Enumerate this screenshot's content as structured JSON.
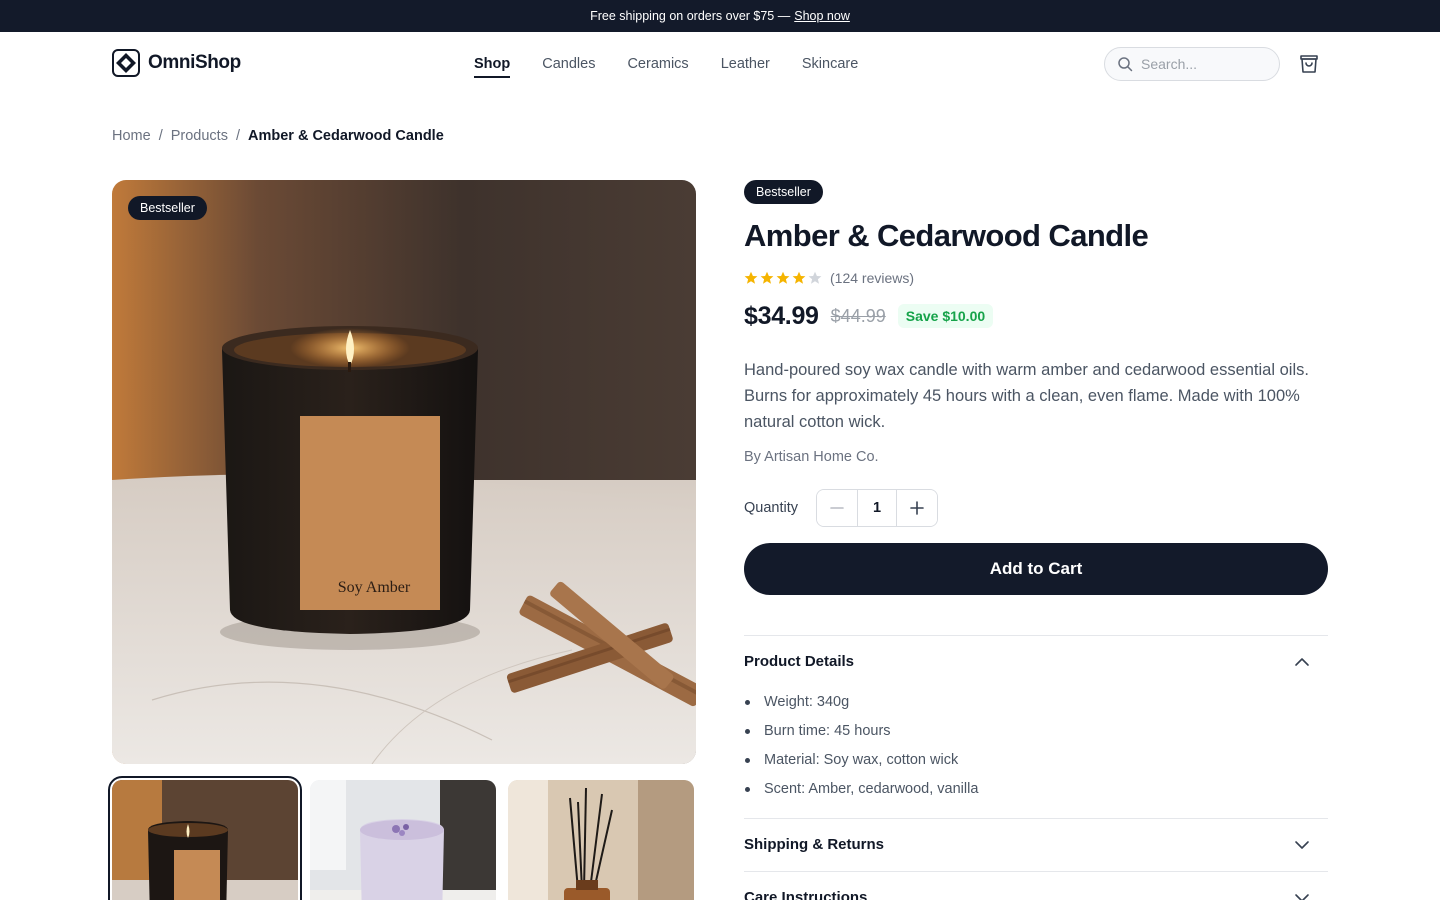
{
  "announcement": {
    "text": "Free shipping on orders over $75 —",
    "link": "Shop now"
  },
  "header": {
    "brand": "OmniShop",
    "nav": [
      {
        "label": "Shop",
        "active": true
      },
      {
        "label": "Candles",
        "active": false
      },
      {
        "label": "Ceramics",
        "active": false
      },
      {
        "label": "Leather",
        "active": false
      },
      {
        "label": "Skincare",
        "active": false
      }
    ],
    "search_placeholder": "Search...",
    "cart_icon": "shopping-bag-icon"
  },
  "breadcrumb": {
    "items": [
      "Home",
      "Products"
    ],
    "current": "Amber & Cedarwood Candle",
    "separator": "/"
  },
  "gallery": {
    "image_badge": "Bestseller",
    "label_text": "Soy Amber",
    "thumbnails": [
      "amber candle",
      "lavender candle",
      "reed diffuser"
    ],
    "selected_index": 0
  },
  "product": {
    "badge": "Bestseller",
    "title": "Amber & Cedarwood Candle",
    "rating": 4,
    "rating_max": 5,
    "reviews": "(124 reviews)",
    "price": "$34.99",
    "compare_price": "$44.99",
    "savings": "Save $10.00",
    "description": "Hand-poured soy wax candle with warm amber and cedarwood essential oils. Burns for approximately 45 hours with a clean, even flame. Made with 100% natural cotton wick.",
    "brand_line": "By Artisan Home Co.",
    "quantity_label": "Quantity",
    "quantity": "1",
    "add_to_cart": "Add to Cart"
  },
  "accordion": [
    {
      "title": "Product Details",
      "expanded": true,
      "items": [
        "Weight: 340g",
        "Burn time: 45 hours",
        "Material: Soy wax, cotton wick",
        "Scent: Amber, cedarwood, vanilla"
      ]
    },
    {
      "title": "Shipping & Returns",
      "expanded": false
    },
    {
      "title": "Care Instructions",
      "expanded": false
    }
  ],
  "colors": {
    "primary": "#131a2a",
    "star": "#f5b400",
    "save": "#16a34a",
    "muted": "#6b7280"
  }
}
